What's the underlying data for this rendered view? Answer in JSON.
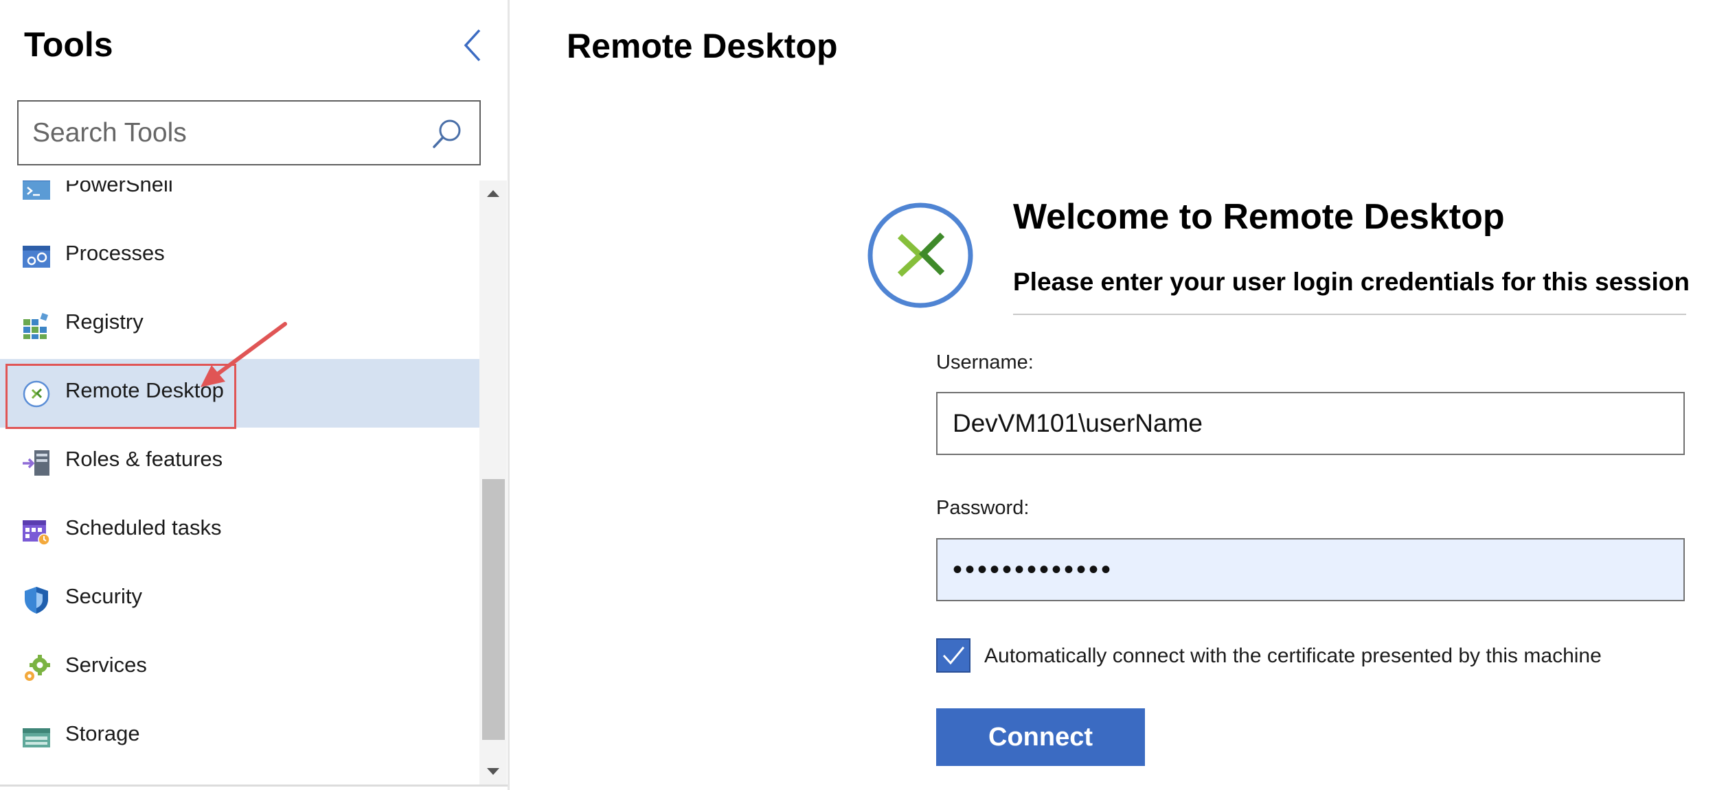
{
  "sidebar": {
    "title": "Tools",
    "collapse_icon": "chevron-left-icon",
    "search": {
      "placeholder": "Search Tools",
      "value": "",
      "icon": "search-icon"
    },
    "items": [
      {
        "label": "PowerShell",
        "icon": "powershell-icon",
        "selected": false
      },
      {
        "label": "Processes",
        "icon": "processes-icon",
        "selected": false
      },
      {
        "label": "Registry",
        "icon": "registry-icon",
        "selected": false
      },
      {
        "label": "Remote Desktop",
        "icon": "remote-desktop-icon",
        "selected": true
      },
      {
        "label": "Roles & features",
        "icon": "roles-features-icon",
        "selected": false
      },
      {
        "label": "Scheduled tasks",
        "icon": "scheduled-tasks-icon",
        "selected": false
      },
      {
        "label": "Security",
        "icon": "shield-icon",
        "selected": false
      },
      {
        "label": "Services",
        "icon": "services-gear-icon",
        "selected": false
      },
      {
        "label": "Storage",
        "icon": "storage-icon",
        "selected": false
      }
    ]
  },
  "main": {
    "title": "Remote Desktop",
    "welcome": {
      "heading": "Welcome to Remote Desktop",
      "subheading": "Please enter your user login credentials for this session"
    },
    "form": {
      "username_label": "Username:",
      "username_value": "DevVM101\\userName",
      "password_label": "Password:",
      "password_value": "•••••••••••••",
      "auto_connect_label": "Automatically connect with the certificate presented by this machine",
      "auto_connect_checked": true,
      "connect_label": "Connect"
    }
  },
  "colors": {
    "selection_bg": "#d5e1f1",
    "accent_blue": "#3b6bc2",
    "highlight_red": "#e05555",
    "password_bg": "#e8f0fe"
  }
}
